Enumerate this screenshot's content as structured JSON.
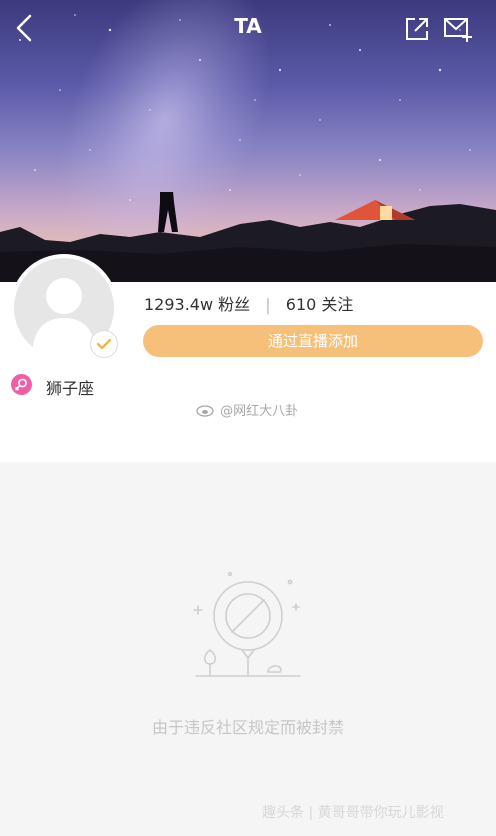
{
  "header": {
    "title": "TA",
    "back_icon": "chevron-left-icon",
    "share_icon": "share-out-icon",
    "mail_icon": "mail-plus-icon"
  },
  "profile": {
    "fans_count": "1293.4w",
    "fans_label": "粉丝",
    "following_count": "610",
    "following_label": "关注",
    "separator": "|",
    "live_button_label": "通过直播添加",
    "zodiac": "狮子座",
    "accent_color": "#f7c07a",
    "zodiac_icon_color": "#f05fa6"
  },
  "watermarks": {
    "weibo": "@网红大八卦",
    "footer": "趣头条 | 黄哥哥带你玩儿影视"
  },
  "banned": {
    "message": "由于违反社区规定而被封禁"
  }
}
